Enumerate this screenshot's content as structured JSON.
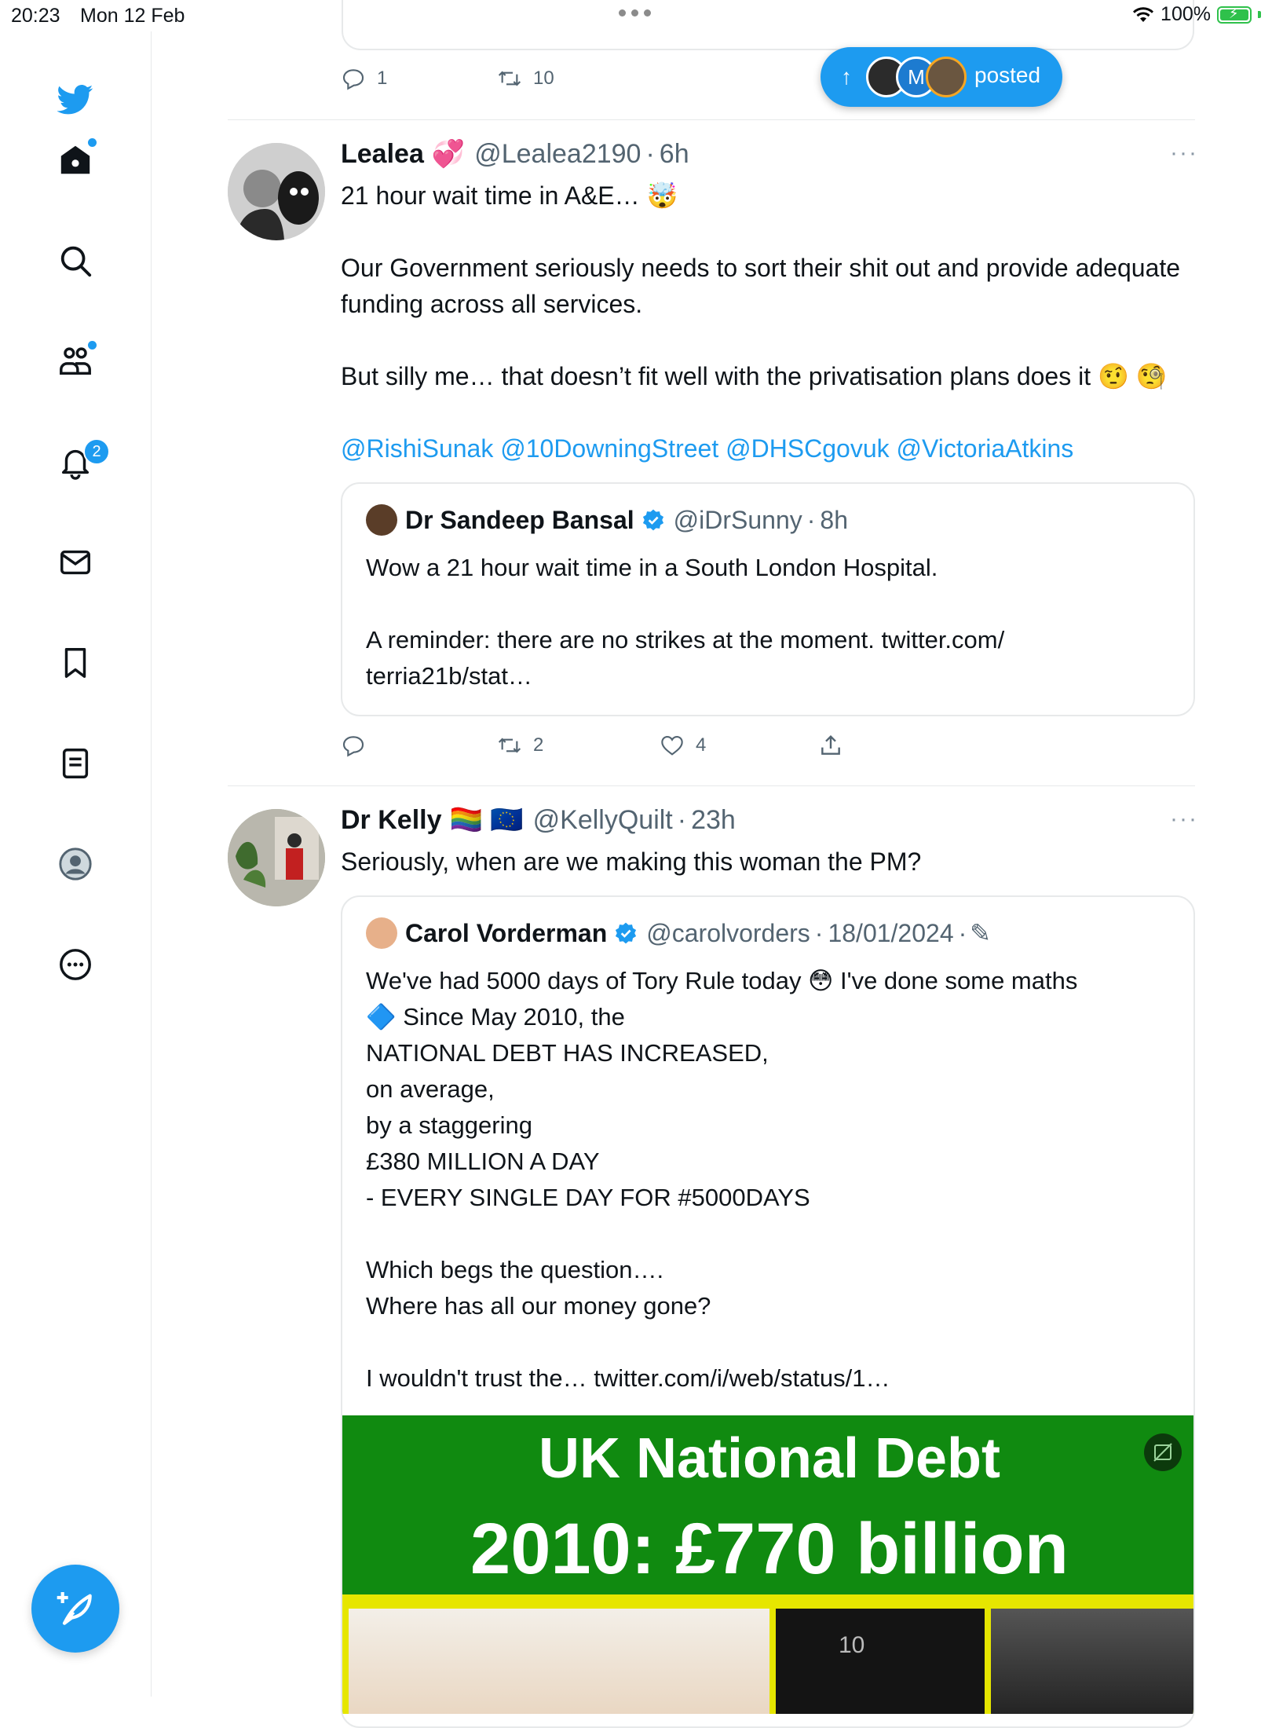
{
  "status_bar": {
    "time": "20:23",
    "date": "Mon 12 Feb",
    "battery": "100%"
  },
  "sidebar": {
    "items": [
      "twitter-logo",
      "home",
      "search",
      "communities",
      "notifications",
      "messages",
      "bookmarks",
      "lists",
      "profile",
      "more"
    ],
    "notifications_badge": "2"
  },
  "previous_tweet": {
    "reply_count": "1",
    "retweet_count": "10"
  },
  "posted_pill": {
    "label": "posted",
    "avatar_initial": "M"
  },
  "tweets": [
    {
      "name": "Lealea",
      "name_emoji": "💞",
      "handle": "@Lealea2190",
      "time": "6h",
      "text": "21 hour wait time in A&E… 🤯\n\nOur Government seriously needs to sort their shit out and provide adequate funding across all services.\n\nBut silly me… that doesn’t fit well with the privatisation plans does it 🤨 🧐",
      "mentions": "@RishiSunak @10DowningStreet @DHSCgovuk @VictoriaAtkins",
      "quote": {
        "name": "Dr Sandeep Bansal",
        "handle": "@iDrSunny",
        "time": "8h",
        "text": "Wow a 21 hour wait time in a South London Hospital.\n\nA reminder: there are no strikes at the moment. twitter.com/\nterria21b/stat…"
      },
      "actions": {
        "replies": "",
        "retweets": "2",
        "likes": "4"
      }
    },
    {
      "name": "Dr Kelly",
      "name_emoji": "🏳️‍🌈 🇪🇺",
      "handle": "@KellyQuilt",
      "time": "23h",
      "text": "Seriously, when are we making this woman the PM?",
      "quote": {
        "name": "Carol Vorderman",
        "handle": "@carolvorders",
        "time": "18/01/2024",
        "text": "We've had 5000 days of Tory Rule today 😳 I've done some maths\n🔷 Since May 2010, the\nNATIONAL DEBT HAS INCREASED,\non average,\nby a staggering\n£380 MILLION A DAY\n- EVERY SINGLE DAY FOR #5000DAYS\n\nWhich begs the question….\nWhere has all our money gone?\n\nI wouldn't trust the… twitter.com/i/web/status/1…",
        "media": {
          "title": "UK National Debt",
          "subtitle": "2010: £770 billion",
          "door_number": "10"
        }
      }
    }
  ],
  "colors": {
    "accent": "#1d9bf0",
    "text": "#0f1419",
    "secondary": "#536471",
    "border": "#e7e9ea",
    "media_green": "#108a10",
    "media_yellow": "#e6e600"
  }
}
